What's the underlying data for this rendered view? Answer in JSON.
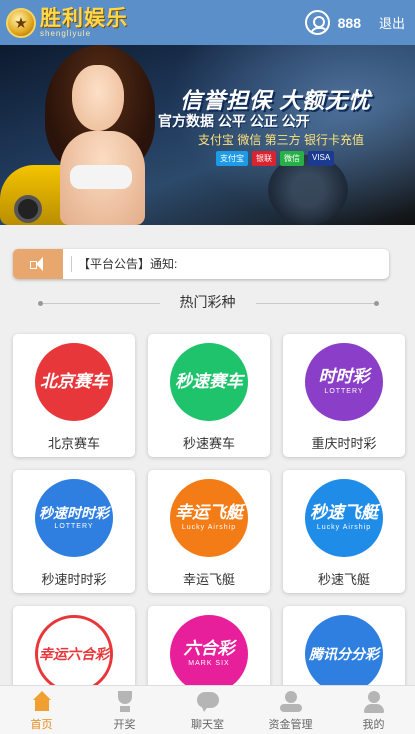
{
  "header": {
    "logo_text": "胜利娱乐",
    "logo_subtitle": "shengliyule",
    "username": "888",
    "logout_label": "退出"
  },
  "banner": {
    "slogan": "信誉担保 大额无忧",
    "line2": "官方数据 公平 公正 公开",
    "line3": "支付宝 微信 第三方 银行卡充值",
    "payments": [
      "支付宝",
      "银联",
      "微信",
      "VISA"
    ]
  },
  "notice": {
    "text": "【平台公告】通知:"
  },
  "section": {
    "title": "热门彩种"
  },
  "games": [
    {
      "label": "北京赛车",
      "badge_main": "北京赛车",
      "badge_sub": "",
      "color": "#e8373a"
    },
    {
      "label": "秒速赛车",
      "badge_main": "秒速赛车",
      "badge_sub": "",
      "color": "#1ec36b"
    },
    {
      "label": "重庆时时彩",
      "badge_main": "时时彩",
      "badge_sub": "LOTTERY",
      "color": "#8b3fc9"
    },
    {
      "label": "秒速时时彩",
      "badge_main": "秒速时时彩",
      "badge_sub": "LOTTERY",
      "color": "#2e7fe0"
    },
    {
      "label": "幸运飞艇",
      "badge_main": "幸运飞艇",
      "badge_sub": "Lucky Airship",
      "color": "#f47c16"
    },
    {
      "label": "秒速飞艇",
      "badge_main": "秒速飞艇",
      "badge_sub": "Lucky Airship",
      "color": "#1f8de8"
    },
    {
      "label": "",
      "badge_main": "幸运六合彩",
      "badge_sub": "",
      "color": "#e8373a"
    },
    {
      "label": "",
      "badge_main": "六合彩",
      "badge_sub": "MARK SIX",
      "color": "#e81f9a"
    },
    {
      "label": "",
      "badge_main": "腾讯分分彩",
      "badge_sub": "",
      "color": "#2e7fe0"
    }
  ],
  "nav": {
    "items": [
      {
        "label": "首页",
        "icon": "home-icon"
      },
      {
        "label": "开奖",
        "icon": "trophy-icon"
      },
      {
        "label": "聊天室",
        "icon": "chat-icon"
      },
      {
        "label": "资金管理",
        "icon": "money-icon"
      },
      {
        "label": "我的",
        "icon": "user-icon"
      }
    ]
  }
}
